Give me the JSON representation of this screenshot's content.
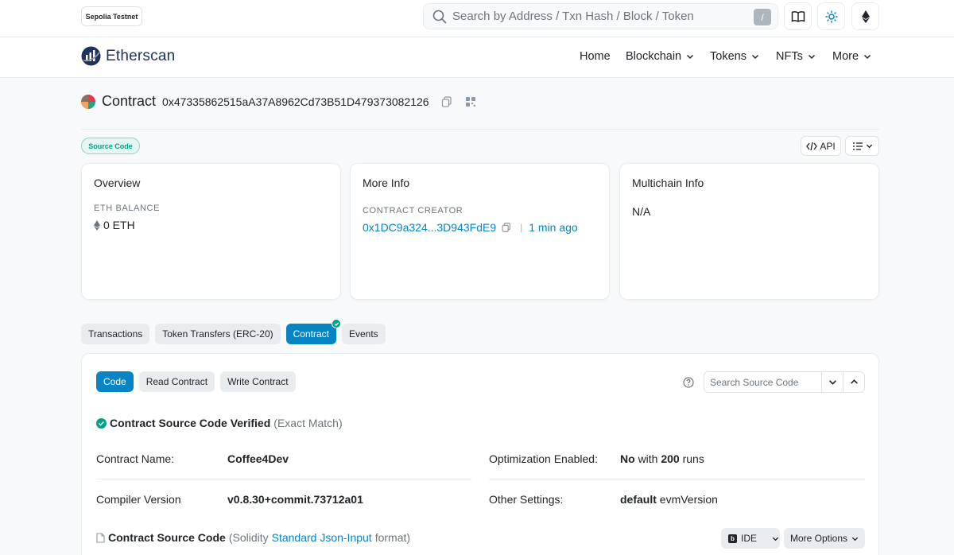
{
  "topbar": {
    "network": "Sepolia Testnet",
    "search_placeholder": "Search by Address / Txn Hash / Block / Token",
    "slash_key": "/"
  },
  "navbar": {
    "brand": "Etherscan",
    "items": [
      {
        "label": "Home",
        "dropdown": false
      },
      {
        "label": "Blockchain",
        "dropdown": true
      },
      {
        "label": "Tokens",
        "dropdown": true
      },
      {
        "label": "NFTs",
        "dropdown": true
      },
      {
        "label": "More",
        "dropdown": true
      }
    ]
  },
  "contract": {
    "title": "Contract",
    "address": "0x47335862515aA37A8962Cd73B51D479373082126",
    "badge": "Source Code",
    "api_label": "API"
  },
  "overview": {
    "title": "Overview",
    "balance_label": "ETH BALANCE",
    "balance_value": "0 ETH"
  },
  "more_info": {
    "title": "More Info",
    "creator_label": "CONTRACT CREATOR",
    "creator_address": "0x1DC9a324...3D943FdE9",
    "separator": "|",
    "creator_time": "1 min ago"
  },
  "multichain": {
    "title": "Multichain Info",
    "value": "N/A"
  },
  "tabs": [
    {
      "label": "Transactions",
      "active": false
    },
    {
      "label": "Token Transfers (ERC-20)",
      "active": false
    },
    {
      "label": "Contract",
      "active": true
    },
    {
      "label": "Events",
      "active": false
    }
  ],
  "code_panel": {
    "subtabs": [
      {
        "label": "Code",
        "active": true
      },
      {
        "label": "Read Contract",
        "active": false
      },
      {
        "label": "Write Contract",
        "active": false
      }
    ],
    "search_placeholder": "Search Source Code",
    "verified_text": "Contract Source Code Verified",
    "verified_note": "(Exact Match)",
    "contract_name_label": "Contract Name:",
    "contract_name_value": "Coffee4Dev",
    "optimization_label": "Optimization Enabled:",
    "optimization_no": "No",
    "optimization_with": "with",
    "optimization_runs": "200",
    "optimization_runs_label": "runs",
    "compiler_label": "Compiler Version",
    "compiler_value": "v0.8.30+commit.73712a01",
    "other_settings_label": "Other Settings:",
    "other_settings_value": "default",
    "other_settings_suffix": "evmVersion",
    "source_title": "Contract Source Code",
    "source_format_prefix": "(Solidity",
    "source_format_link": "Standard Json-Input",
    "source_format_suffix": "format)",
    "ide_label": "IDE",
    "ide_glyph": "b",
    "more_options_label": "More Options"
  },
  "colors": {
    "accent": "#0784c3",
    "success": "#00a186",
    "brand": "#21325b"
  }
}
